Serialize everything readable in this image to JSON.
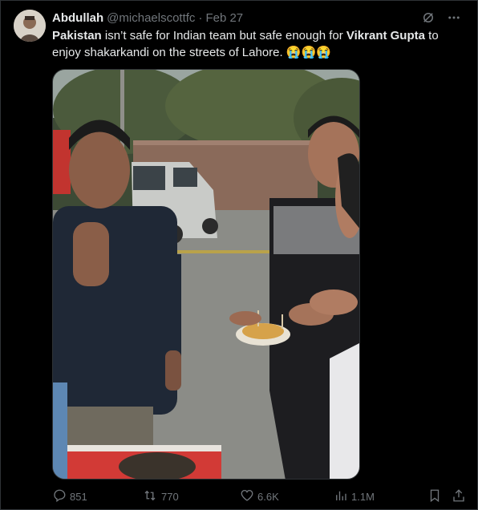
{
  "tweet": {
    "author_name": "Abdullah",
    "author_handle": "@michaelscottfc",
    "separator": "·",
    "date": "Feb 27",
    "text_bold_1": "Pakistan",
    "text_part_1": " isn’t safe for Indian team but safe enough for ",
    "text_bold_2": "Vikrant Gupta",
    "text_part_2": " to enjoy shakarkandi on the streets of Lahore. ",
    "text_emojis": "😭😭😭"
  },
  "actions": {
    "replies": "851",
    "reposts": "770",
    "likes": "6.6K",
    "views": "1.1M"
  },
  "icons": {
    "grok": "grok-icon",
    "more": "more-icon",
    "reply": "reply-icon",
    "repost": "repost-icon",
    "like": "like-icon",
    "views": "views-icon",
    "bookmark": "bookmark-icon",
    "share": "share-icon"
  },
  "colors": {
    "background": "#000000",
    "text": "#e7e9ea",
    "secondary": "#71767b",
    "border": "#2f3336"
  }
}
